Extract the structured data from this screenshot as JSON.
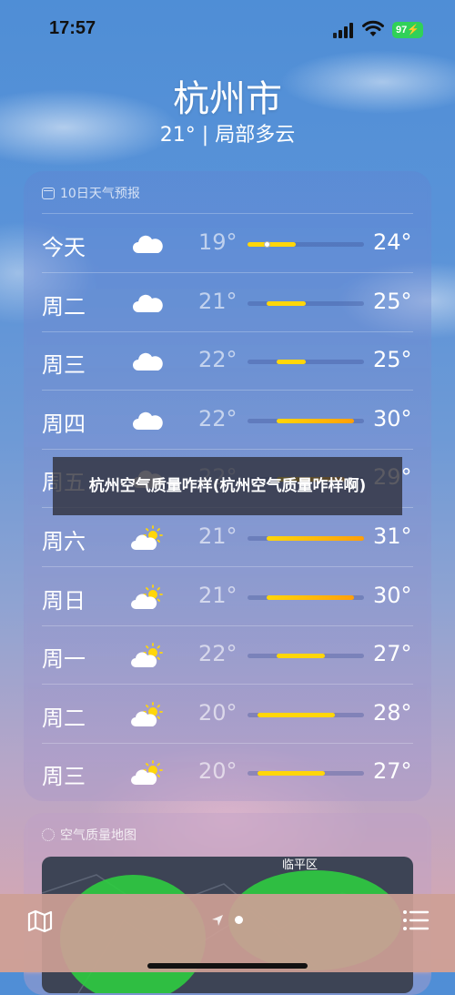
{
  "status_bar": {
    "time": "17:57",
    "battery": "97"
  },
  "location": {
    "city": "杭州市",
    "current": "21° | 局部多云"
  },
  "forecast": {
    "header": "10日天气预报",
    "scale_min": 19,
    "scale_max": 31,
    "days": [
      {
        "day": "今天",
        "icon": "cloud-icon",
        "low": "19°",
        "high": "24°",
        "low_val": 19,
        "high_val": 24,
        "current": 21
      },
      {
        "day": "周二",
        "icon": "cloud-icon",
        "low": "21°",
        "high": "25°",
        "low_val": 21,
        "high_val": 25
      },
      {
        "day": "周三",
        "icon": "cloud-icon",
        "low": "22°",
        "high": "25°",
        "low_val": 22,
        "high_val": 25
      },
      {
        "day": "周四",
        "icon": "cloud-icon",
        "low": "22°",
        "high": "30°",
        "low_val": 22,
        "high_val": 30
      },
      {
        "day": "周五",
        "icon": "cloud-icon",
        "low": "22°",
        "high": "29°",
        "low_val": 22,
        "high_val": 29
      },
      {
        "day": "周六",
        "icon": "partly-sunny-icon",
        "low": "21°",
        "high": "31°",
        "low_val": 21,
        "high_val": 31
      },
      {
        "day": "周日",
        "icon": "partly-sunny-icon",
        "low": "21°",
        "high": "30°",
        "low_val": 21,
        "high_val": 30
      },
      {
        "day": "周一",
        "icon": "partly-sunny-icon",
        "low": "22°",
        "high": "27°",
        "low_val": 22,
        "high_val": 27
      },
      {
        "day": "周二",
        "icon": "partly-sunny-icon",
        "low": "20°",
        "high": "28°",
        "low_val": 20,
        "high_val": 28
      },
      {
        "day": "周三",
        "icon": "partly-sunny-icon",
        "low": "20°",
        "high": "27°",
        "low_val": 20,
        "high_val": 27
      }
    ]
  },
  "air_quality": {
    "header": "空气质量地图",
    "map_label": "临平区"
  },
  "overlay": {
    "text": "杭州空气质量咋样(杭州空气质量咋样啊)"
  },
  "colors": {
    "bar_cool": "#ffd60a",
    "bar_warm": "#ff9f0a",
    "map_green": "#2ecc40"
  }
}
